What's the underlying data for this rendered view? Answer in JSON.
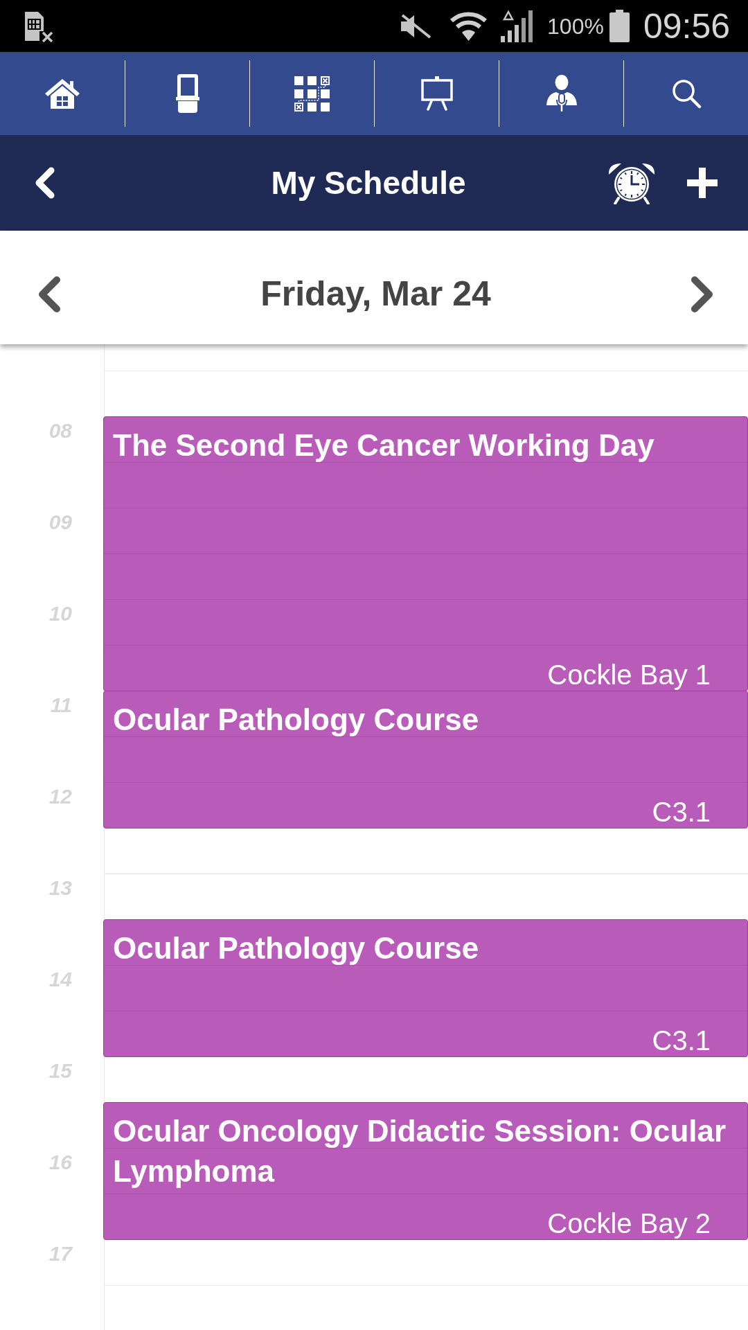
{
  "status_bar": {
    "battery_percent": "100%",
    "time": "09:56"
  },
  "header": {
    "title": "My Schedule"
  },
  "date_bar": {
    "date": "Friday, Mar 24"
  },
  "schedule": {
    "hours": [
      "08",
      "09",
      "10",
      "11",
      "12",
      "13",
      "14",
      "15",
      "16",
      "17"
    ],
    "events": [
      {
        "title": "The Second Eye Cancer Working Day",
        "location": "Cockle Bay 1"
      },
      {
        "title": "Ocular Pathology Course",
        "location": "C3.1"
      },
      {
        "title": "Ocular Pathology Course",
        "location": "C3.1"
      },
      {
        "title": "Ocular Oncology Didactic Session: Ocular Lymphoma",
        "location": "Cockle Bay 2"
      }
    ]
  }
}
